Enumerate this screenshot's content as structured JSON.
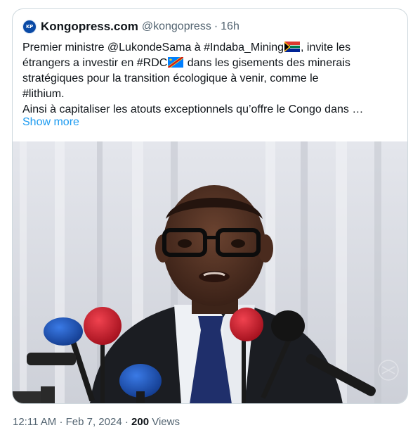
{
  "quote": {
    "author_name": "Kongopress.com",
    "author_handle": "@kongopress",
    "separator": "·",
    "time_ago": "16h",
    "avatar_text": "KP",
    "text_lines": [
      "Premier ministre @LukondeSama à #Indaba_Mining",
      ", invite les",
      "étrangers a investir en #RDC",
      " dans les gisements des minerais",
      "stratégiques pour la transition écologique à venir, comme le",
      "#lithium.",
      "Ainsi à capitaliser les atouts exceptionnels qu’offre le Congo dans …"
    ],
    "show_more": "Show more",
    "flags": [
      "south-africa-flag-icon",
      "drc-flag-icon"
    ]
  },
  "post_meta": {
    "time": "12:11 AM",
    "separator": "·",
    "date": "Feb 7, 2024",
    "separator2": "·",
    "views_count": "200",
    "views_label": "Views"
  },
  "colors": {
    "link": "#1d9bf0",
    "secondary_text": "#536471",
    "border": "#cfd9de"
  }
}
